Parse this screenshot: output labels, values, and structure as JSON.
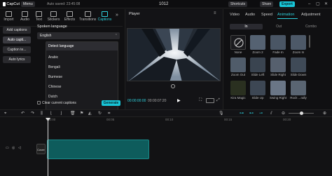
{
  "top": {
    "app": "CapCut",
    "menu": "Menu",
    "autosave": "Auto saved: 23:45:08",
    "project": "1012",
    "shortcuts": "Shortcuts",
    "share": "Share",
    "export": "Export"
  },
  "tools": [
    {
      "label": "Import",
      "icon": "import-icon"
    },
    {
      "label": "Audio",
      "icon": "audio-icon"
    },
    {
      "label": "Text",
      "icon": "text-icon"
    },
    {
      "label": "Stickers",
      "icon": "stickers-icon"
    },
    {
      "label": "Effects",
      "icon": "effects-icon"
    },
    {
      "label": "Transitions",
      "icon": "transitions-icon"
    },
    {
      "label": "Captions",
      "icon": "captions-icon"
    }
  ],
  "leftnav": [
    "Add captions",
    "Auto capti...",
    "Caption te...",
    "Auto lyrics"
  ],
  "captions": {
    "spoken_language_label": "Spoken language",
    "selected": "English",
    "options": [
      "Detect language",
      "Arabic",
      "Bengali",
      "Burmese",
      "Chinese",
      "Dutch"
    ],
    "clear_label": "Clear current captions",
    "generate": "Generate"
  },
  "player": {
    "title": "Player",
    "current": "00:00:00:00",
    "total": "00:00:07:20"
  },
  "right": {
    "tabs": [
      "Video",
      "Audio",
      "Speed",
      "Animation",
      "Adjustment"
    ],
    "subtabs": [
      "In",
      "Out",
      "Combo"
    ],
    "effects": [
      "None",
      "Zoom 2",
      "Fade In",
      "Zoom In",
      "Zoom Out",
      "Slide Left",
      "Slide Right",
      "Slide Down",
      "Kira Magic",
      "Slide Up",
      "Swing Right",
      "Rock ...rally"
    ]
  },
  "timeline": {
    "cover": "Cover",
    "ruler": [
      "00:00",
      "00:05",
      "00:10",
      "00:15",
      "00:20"
    ]
  }
}
